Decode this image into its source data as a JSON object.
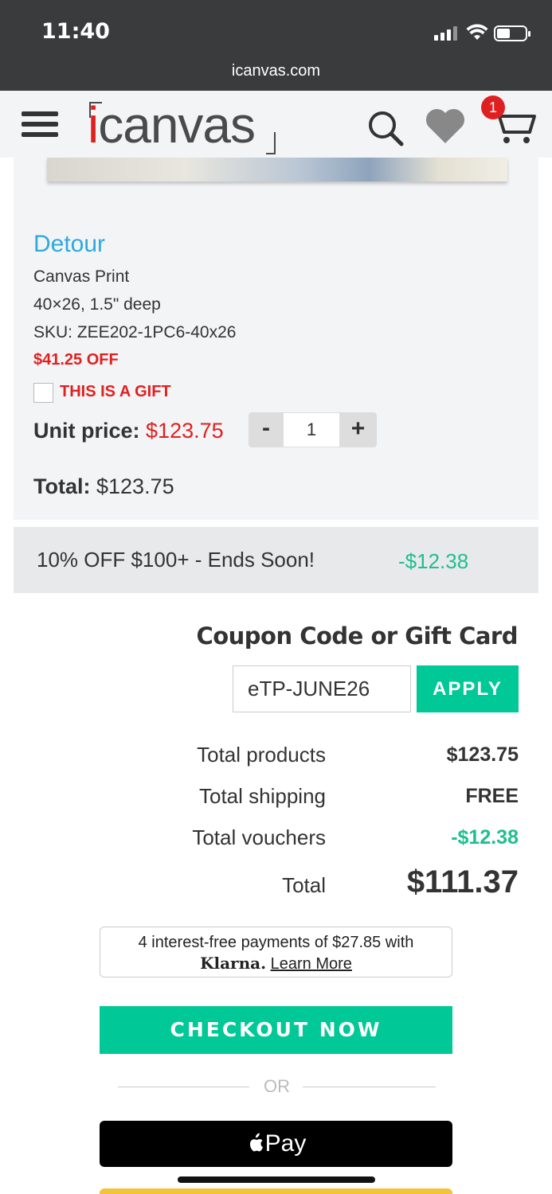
{
  "status_bar": {
    "time": "11:40",
    "url": "icanvas.com",
    "icons": [
      "signal-icon",
      "wifi-icon",
      "battery-icon"
    ]
  },
  "header": {
    "logo_i": "i",
    "logo_rest": "canvas",
    "cart_count": "1",
    "icons": [
      "hamburger-icon",
      "search-icon",
      "heart-icon",
      "cart-icon"
    ]
  },
  "product": {
    "title": "Detour",
    "type": "Canvas Print",
    "size": "40×26, 1.5\" deep",
    "sku": "SKU: ZEE202-1PC6-40x26",
    "discount": "$41.25 OFF",
    "gift_label": "THIS IS A GIFT",
    "unit_price_label": "Unit price:",
    "unit_price": "$123.75",
    "quantity": "1",
    "qty_minus": "-",
    "qty_plus": "+",
    "total_label": "Total:",
    "total": "$123.75"
  },
  "promo": {
    "text": "10% OFF $100+ - Ends Soon!",
    "amount": "-$12.38"
  },
  "coupon": {
    "title": "Coupon Code or Gift Card",
    "value": "eTP-JUNE26",
    "apply_label": "APPLY"
  },
  "summary": {
    "products_label": "Total products",
    "products_value": "$123.75",
    "shipping_label": "Total shipping",
    "shipping_value": "FREE",
    "vouchers_label": "Total vouchers",
    "vouchers_value": "-$12.38",
    "total_label": "Total",
    "total_value": "$111.37"
  },
  "klarna": {
    "line1": "4 interest-free payments of $27.85 with",
    "brand": "Klarna.",
    "learn_more": "Learn More"
  },
  "checkout": {
    "label": "CHECKOUT NOW",
    "or": "OR",
    "apple_pay_label": "Pay"
  },
  "colors": {
    "accent_green": "#00c896",
    "price_red": "#e02020",
    "link_blue": "#2ea8df"
  }
}
